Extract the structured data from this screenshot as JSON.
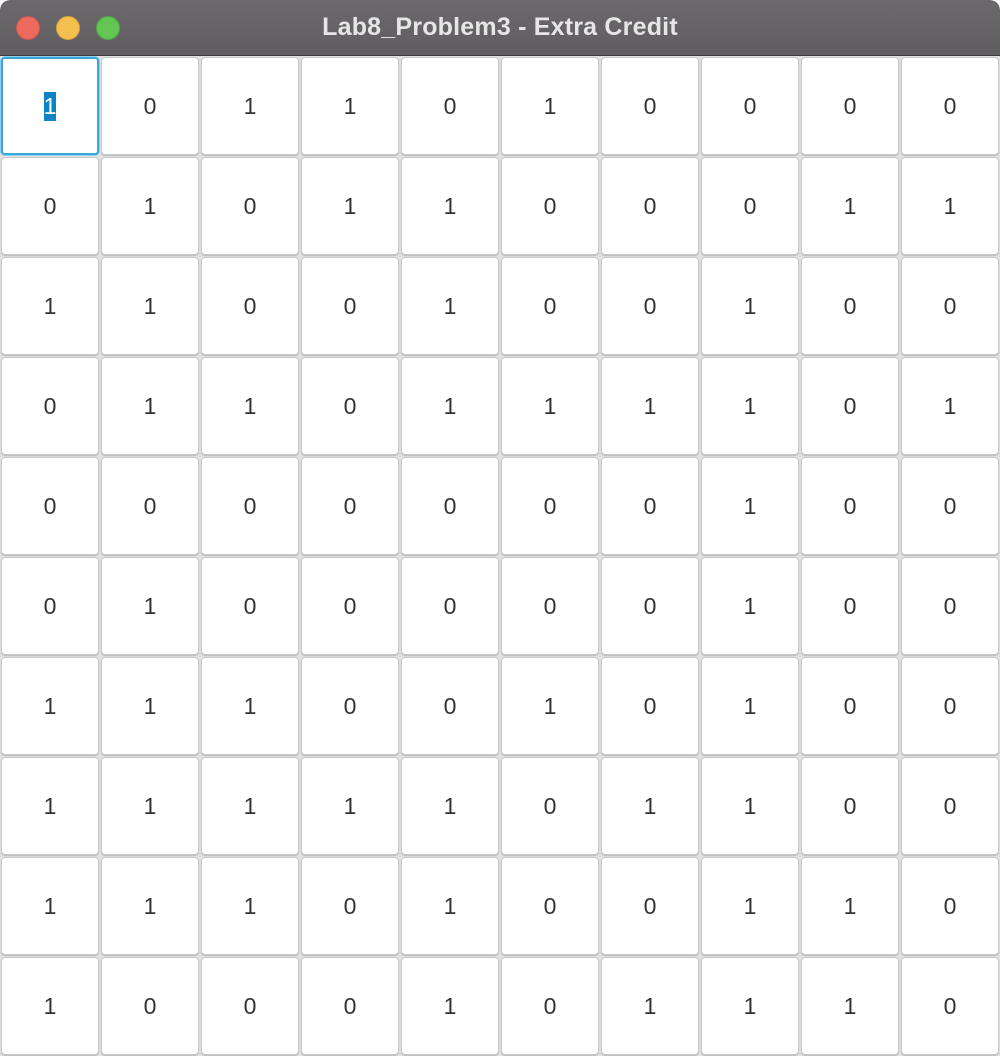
{
  "window": {
    "title": "Lab8_Problem3 - Extra Credit"
  },
  "colors": {
    "titlebar": "#656366",
    "focus_ring": "#3aa7d9",
    "selection": "#0a84c4",
    "close": "#ed6a5e",
    "minimize": "#f5bf4f",
    "zoom": "#62c554"
  },
  "grid": {
    "focused_cell": [
      0,
      0
    ],
    "rows": [
      [
        "1",
        "0",
        "1",
        "1",
        "0",
        "1",
        "0",
        "0",
        "0",
        "0"
      ],
      [
        "0",
        "1",
        "0",
        "1",
        "1",
        "0",
        "0",
        "0",
        "1",
        "1"
      ],
      [
        "1",
        "1",
        "0",
        "0",
        "1",
        "0",
        "0",
        "1",
        "0",
        "0"
      ],
      [
        "0",
        "1",
        "1",
        "0",
        "1",
        "1",
        "1",
        "1",
        "0",
        "1"
      ],
      [
        "0",
        "0",
        "0",
        "0",
        "0",
        "0",
        "0",
        "1",
        "0",
        "0"
      ],
      [
        "0",
        "1",
        "0",
        "0",
        "0",
        "0",
        "0",
        "1",
        "0",
        "0"
      ],
      [
        "1",
        "1",
        "1",
        "0",
        "0",
        "1",
        "0",
        "1",
        "0",
        "0"
      ],
      [
        "1",
        "1",
        "1",
        "1",
        "1",
        "0",
        "1",
        "1",
        "0",
        "0"
      ],
      [
        "1",
        "1",
        "1",
        "0",
        "1",
        "0",
        "0",
        "1",
        "1",
        "0"
      ],
      [
        "1",
        "0",
        "0",
        "0",
        "1",
        "0",
        "1",
        "1",
        "1",
        "0"
      ]
    ]
  }
}
